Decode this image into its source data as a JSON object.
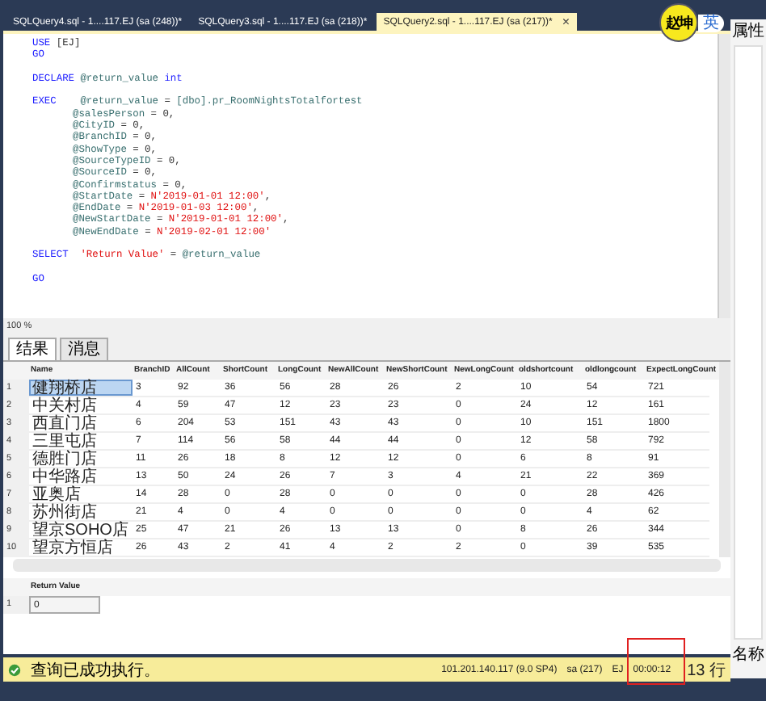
{
  "tabs": [
    {
      "label": "SQLQuery4.sql - 1....117.EJ (sa (248))*",
      "selected": false
    },
    {
      "label": "SQLQuery3.sql - 1....117.EJ (sa (218))*",
      "selected": false
    },
    {
      "label": "SQLQuery2.sql - 1....117.EJ (sa (217))*",
      "selected": true,
      "close": "×"
    }
  ],
  "ime_badge": {
    "name": "赵坤",
    "mode": "英"
  },
  "editor": {
    "lines": [
      {
        "tokens": [
          {
            "kind": "keyword",
            "text": "USE "
          },
          {
            "kind": "plain",
            "text": "[EJ]"
          }
        ]
      },
      {
        "tokens": [
          {
            "kind": "keyword",
            "text": "GO"
          }
        ]
      },
      {
        "gap_before": true,
        "tokens": [
          {
            "kind": "keyword",
            "text": "DECLARE "
          },
          {
            "kind": "identifier",
            "text": "@return_value "
          },
          {
            "kind": "keyword",
            "text": "int"
          }
        ]
      },
      {
        "gap_before": true,
        "tokens": [
          {
            "kind": "keyword",
            "text": "EXEC    "
          },
          {
            "kind": "identifier",
            "text": "@return_value"
          },
          {
            "kind": "plain",
            "text": " = "
          },
          {
            "kind": "identifier",
            "text": "[dbo].pr_RoomNightsTotalfortest"
          }
        ]
      },
      {
        "continuation": true,
        "tokens": [
          {
            "kind": "identifier",
            "text": "@salesPerson"
          },
          {
            "kind": "plain",
            "text": " = 0,"
          }
        ]
      },
      {
        "continuation": true,
        "tokens": [
          {
            "kind": "identifier",
            "text": "@CityID"
          },
          {
            "kind": "plain",
            "text": " = 0,"
          }
        ]
      },
      {
        "continuation": true,
        "tokens": [
          {
            "kind": "identifier",
            "text": "@BranchID"
          },
          {
            "kind": "plain",
            "text": " = 0,"
          }
        ]
      },
      {
        "continuation": true,
        "tokens": [
          {
            "kind": "identifier",
            "text": "@ShowType"
          },
          {
            "kind": "plain",
            "text": " = 0,"
          }
        ]
      },
      {
        "continuation": true,
        "tokens": [
          {
            "kind": "identifier",
            "text": "@SourceTypeID"
          },
          {
            "kind": "plain",
            "text": " = 0,"
          }
        ]
      },
      {
        "continuation": true,
        "tokens": [
          {
            "kind": "identifier",
            "text": "@SourceID"
          },
          {
            "kind": "plain",
            "text": " = 0,"
          }
        ]
      },
      {
        "continuation": true,
        "tokens": [
          {
            "kind": "identifier",
            "text": "@Confirmstatus"
          },
          {
            "kind": "plain",
            "text": " = 0,"
          }
        ]
      },
      {
        "continuation": true,
        "tokens": [
          {
            "kind": "identifier",
            "text": "@StartDate"
          },
          {
            "kind": "plain",
            "text": " = "
          },
          {
            "kind": "string",
            "text": "N'2019-01-01 12:00'"
          },
          {
            "kind": "plain",
            "text": ","
          }
        ]
      },
      {
        "continuation": true,
        "tokens": [
          {
            "kind": "identifier",
            "text": "@EndDate"
          },
          {
            "kind": "plain",
            "text": " = "
          },
          {
            "kind": "string",
            "text": "N'2019-01-03 12:00'"
          },
          {
            "kind": "plain",
            "text": ","
          }
        ]
      },
      {
        "continuation": true,
        "tokens": [
          {
            "kind": "identifier",
            "text": "@NewStartDate"
          },
          {
            "kind": "plain",
            "text": " = "
          },
          {
            "kind": "string",
            "text": "N'2019-01-01 12:00'"
          },
          {
            "kind": "plain",
            "text": ","
          }
        ]
      },
      {
        "continuation": true,
        "tokens": [
          {
            "kind": "identifier",
            "text": "@NewEndDate"
          },
          {
            "kind": "plain",
            "text": " = "
          },
          {
            "kind": "string",
            "text": "N'2019-02-01 12:00'"
          }
        ]
      },
      {
        "gap_before": true,
        "tokens": [
          {
            "kind": "keyword",
            "text": "SELECT  "
          },
          {
            "kind": "string",
            "text": "'Return Value'"
          },
          {
            "kind": "plain",
            "text": " = "
          },
          {
            "kind": "identifier",
            "text": "@return_value"
          }
        ]
      },
      {
        "gap_before": true,
        "tokens": [
          {
            "kind": "keyword",
            "text": "GO"
          }
        ]
      }
    ]
  },
  "zoom": "100 %",
  "result_tabs": [
    {
      "label": "结果",
      "selected": true
    },
    {
      "label": "消息",
      "selected": false
    }
  ],
  "grid": {
    "columns": [
      "Name",
      "BranchID",
      "AllCount",
      "ShortCount",
      "LongCount",
      "NewAllCount",
      "NewShortCount",
      "NewLongCount",
      "oldshortcount",
      "oldlongcount",
      "ExpectLongCount"
    ],
    "rows": [
      {
        "number": "1",
        "selected": true,
        "cells": [
          "健翔桥店",
          "3",
          "92",
          "36",
          "56",
          "28",
          "26",
          "2",
          "10",
          "54",
          "721"
        ]
      },
      {
        "number": "2",
        "selected": false,
        "cells": [
          "中关村店",
          "4",
          "59",
          "47",
          "12",
          "23",
          "23",
          "0",
          "24",
          "12",
          "161"
        ]
      },
      {
        "number": "3",
        "selected": false,
        "cells": [
          "西直门店",
          "6",
          "204",
          "53",
          "151",
          "43",
          "43",
          "0",
          "10",
          "151",
          "1800"
        ]
      },
      {
        "number": "4",
        "selected": false,
        "cells": [
          "三里屯店",
          "7",
          "114",
          "56",
          "58",
          "44",
          "44",
          "0",
          "12",
          "58",
          "792"
        ]
      },
      {
        "number": "5",
        "selected": false,
        "cells": [
          "德胜门店",
          "11",
          "26",
          "18",
          "8",
          "12",
          "12",
          "0",
          "6",
          "8",
          "91"
        ]
      },
      {
        "number": "6",
        "selected": false,
        "cells": [
          "中华路店",
          "13",
          "50",
          "24",
          "26",
          "7",
          "3",
          "4",
          "21",
          "22",
          "369"
        ]
      },
      {
        "number": "7",
        "selected": false,
        "cells": [
          "亚奥店",
          "14",
          "28",
          "0",
          "28",
          "0",
          "0",
          "0",
          "0",
          "28",
          "426"
        ]
      },
      {
        "number": "8",
        "selected": false,
        "cells": [
          "苏州街店",
          "21",
          "4",
          "0",
          "4",
          "0",
          "0",
          "0",
          "0",
          "4",
          "62"
        ]
      },
      {
        "number": "9",
        "selected": false,
        "cells": [
          "望京SOHO店",
          "25",
          "47",
          "21",
          "26",
          "13",
          "13",
          "0",
          "8",
          "26",
          "344"
        ]
      },
      {
        "number": "10",
        "selected": false,
        "cells": [
          "望京方恒店",
          "26",
          "43",
          "2",
          "41",
          "4",
          "2",
          "2",
          "0",
          "39",
          "535"
        ]
      }
    ]
  },
  "return_grid": {
    "column": "Return Value",
    "number": "1",
    "value": "0"
  },
  "status_bar": {
    "message": "查询已成功执行。",
    "server": "101.201.140.117 (9.0 SP4)",
    "user": "sa (217)",
    "database": "EJ",
    "elapsed": "00:00:12",
    "rows": "13 行"
  },
  "side_panel": {
    "title": "属性",
    "label": "名称"
  }
}
